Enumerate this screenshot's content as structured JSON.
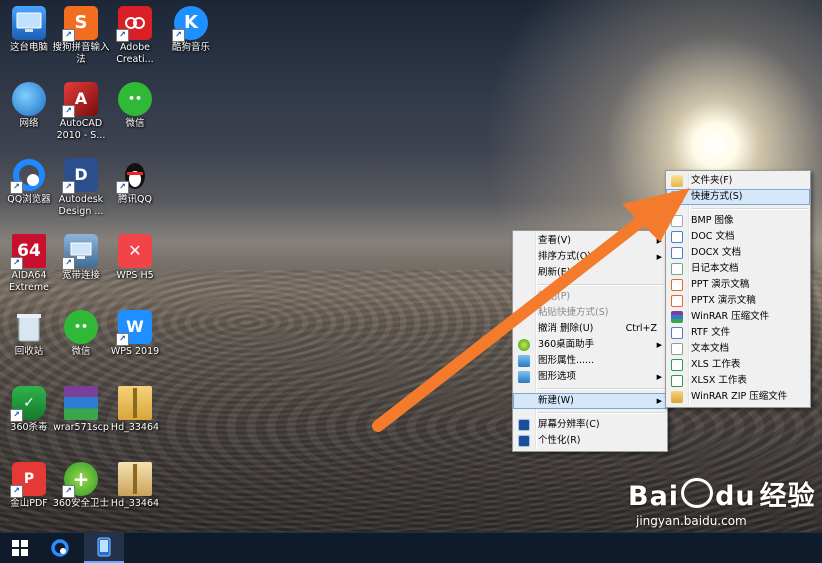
{
  "desktop": {
    "icons": [
      {
        "label": "这台电脑",
        "icon": "computer-icon"
      },
      {
        "label": "搜狗拼音输入法",
        "icon": "sogou-input-icon"
      },
      {
        "label": "Adobe Creati...",
        "icon": "adobe-cc-icon"
      },
      {
        "label": "酷狗音乐",
        "icon": "kugou-music-icon"
      },
      {
        "label": "网络",
        "icon": "network-icon"
      },
      {
        "label": "AutoCAD 2010 - S...",
        "icon": "autocad-icon"
      },
      {
        "label": "微信",
        "icon": "wechat-icon"
      },
      {
        "label": "QQ浏览器",
        "icon": "qq-browser-icon"
      },
      {
        "label": "Autodesk Design ...",
        "icon": "autodesk-design-review-icon"
      },
      {
        "label": "腾讯QQ",
        "icon": "qq-penguin-icon"
      },
      {
        "label": "AIDA64 Extreme",
        "icon": "aida64-icon"
      },
      {
        "label": "宽带连接",
        "icon": "broadband-icon"
      },
      {
        "label": "WPS H5",
        "icon": "wps-h5-icon"
      },
      {
        "label": "回收站",
        "icon": "recycle-bin-icon"
      },
      {
        "label": "微信",
        "icon": "wechat-icon"
      },
      {
        "label": "WPS 2019",
        "icon": "wps-2019-icon"
      },
      {
        "label": "360杀毒",
        "icon": "360-antivirus-icon"
      },
      {
        "label": "wrar571scp",
        "icon": "winrar-icon"
      },
      {
        "label": "Hd_33464",
        "icon": "zip-folder-icon"
      },
      {
        "label": "金山PDF",
        "icon": "kingsoft-pdf-icon"
      },
      {
        "label": "360安全卫士",
        "icon": "360-safeguard-icon"
      },
      {
        "label": "Hd_33464",
        "icon": "zip-folder-icon"
      }
    ]
  },
  "context_menu": {
    "items": [
      {
        "label": "查看(V)",
        "has_submenu": true
      },
      {
        "label": "排序方式(O)",
        "has_submenu": true
      },
      {
        "label": "刷新(E)"
      },
      {
        "label": "粘贴(P)",
        "disabled": true
      },
      {
        "label": "粘贴快捷方式(S)",
        "disabled": true
      },
      {
        "label": "撤消 删除(U)",
        "accelerator": "Ctrl+Z"
      },
      {
        "label": "360桌面助手",
        "has_submenu": true,
        "icon": "360-desktop-icon"
      },
      {
        "label": "图形属性......",
        "icon": "graphics-properties-icon"
      },
      {
        "label": "图形选项",
        "has_submenu": true,
        "icon": "graphics-options-icon"
      },
      {
        "label": "新建(W)",
        "has_submenu": true,
        "highlighted": true
      },
      {
        "label": "屏幕分辨率(C)",
        "icon": "screen-resolution-icon"
      },
      {
        "label": "个性化(R)",
        "icon": "personalize-icon"
      }
    ]
  },
  "new_submenu": {
    "items": [
      {
        "label": "文件夹(F)",
        "icon": "folder-icon"
      },
      {
        "label": "快捷方式(S)",
        "icon": "shortcut-icon",
        "highlighted": true
      },
      {
        "label": "BMP 图像",
        "icon": "bmp-file-icon"
      },
      {
        "label": "DOC 文档",
        "icon": "doc-file-icon"
      },
      {
        "label": "DOCX 文档",
        "icon": "docx-file-icon"
      },
      {
        "label": "日记本文档",
        "icon": "journal-file-icon"
      },
      {
        "label": "PPT 演示文稿",
        "icon": "ppt-file-icon"
      },
      {
        "label": "PPTX 演示文稿",
        "icon": "pptx-file-icon"
      },
      {
        "label": "WinRAR 压缩文件",
        "icon": "rar-file-icon"
      },
      {
        "label": "RTF 文件",
        "icon": "rtf-file-icon"
      },
      {
        "label": "文本文档",
        "icon": "txt-file-icon"
      },
      {
        "label": "XLS 工作表",
        "icon": "xls-file-icon"
      },
      {
        "label": "XLSX 工作表",
        "icon": "xlsx-file-icon"
      },
      {
        "label": "WinRAR ZIP 压缩文件",
        "icon": "zip-file-icon"
      }
    ]
  },
  "taskbar": {
    "buttons": [
      {
        "icon": "windows-start-icon"
      },
      {
        "icon": "qq-browser-icon"
      },
      {
        "icon": "phone-app-icon",
        "active": true
      }
    ]
  },
  "annotation": {
    "arrow_color": "#f47a2c"
  },
  "watermark": {
    "brand": "Bai",
    "brand_mid": "du",
    "brand_cn": "经验",
    "url": "jingyan.baidu.com"
  }
}
